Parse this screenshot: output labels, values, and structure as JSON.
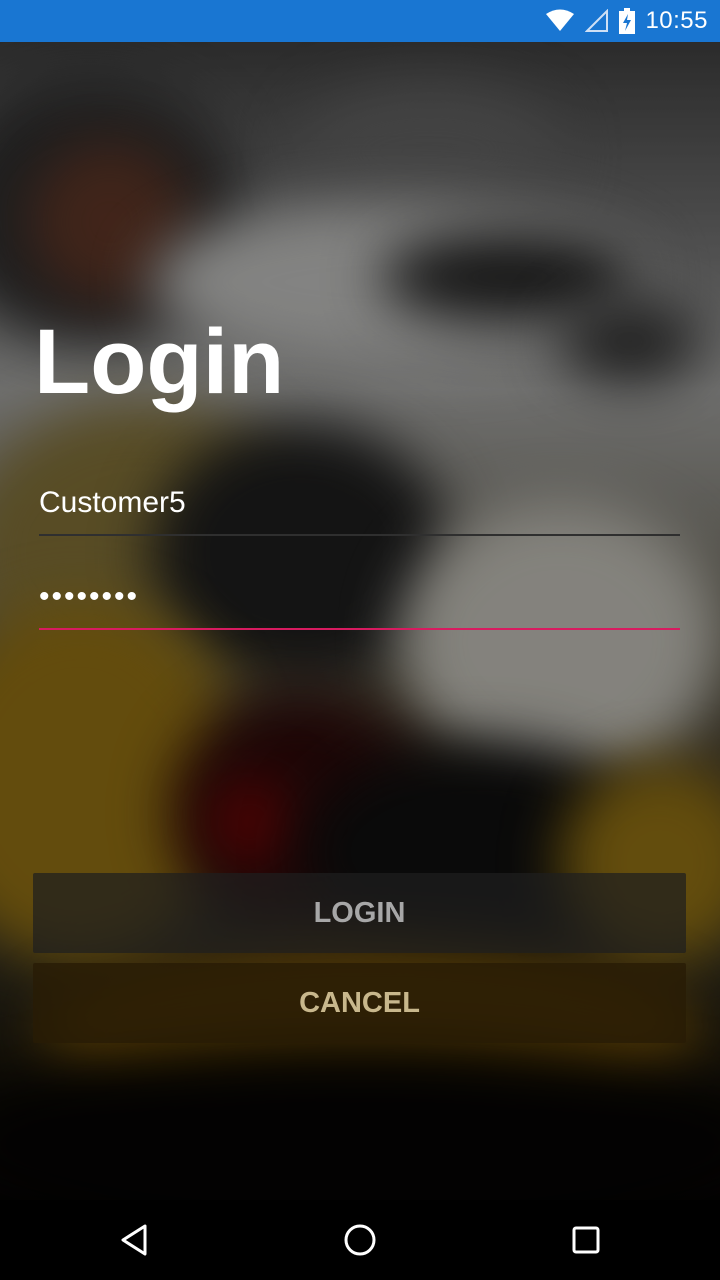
{
  "status_bar": {
    "time": "10:55",
    "icons": [
      "wifi-icon",
      "cellular-signal-icon",
      "battery-charging-icon"
    ],
    "background_color": "#1976d2"
  },
  "login": {
    "title": "Login",
    "username": {
      "value": "Customer5"
    },
    "password": {
      "value": "••••••••"
    },
    "accent_color": "#d81b60",
    "login_button_label": "LOGIN",
    "cancel_button_label": "CANCEL"
  },
  "nav_bar": {
    "buttons": [
      "back-icon",
      "home-icon",
      "recents-icon"
    ]
  }
}
